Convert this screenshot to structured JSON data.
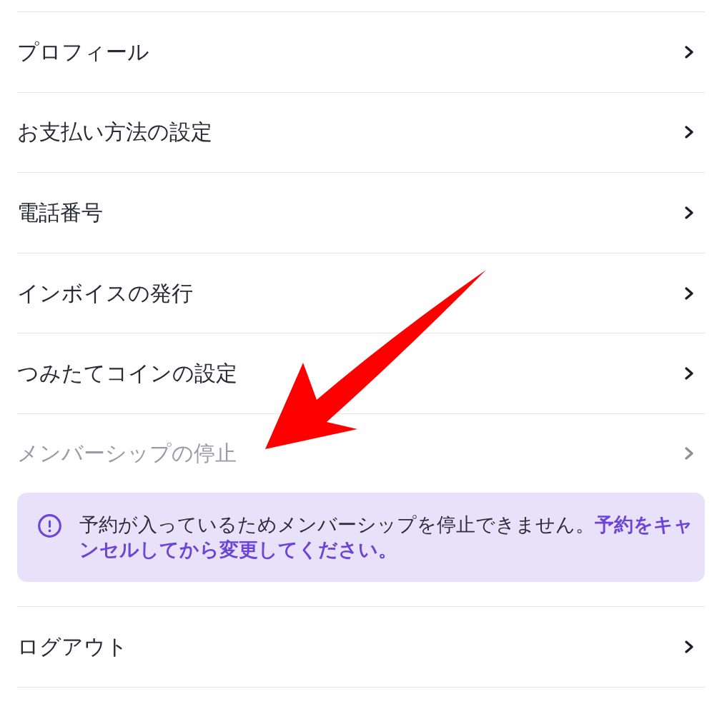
{
  "settings_list": [
    {
      "kind": "link",
      "label": "プロフィール",
      "disabled": false
    },
    {
      "kind": "link",
      "label": "お支払い方法の設定",
      "disabled": false
    },
    {
      "kind": "link",
      "label": "電話番号",
      "disabled": false
    },
    {
      "kind": "link",
      "label": "インボイスの発行",
      "disabled": false
    },
    {
      "kind": "link",
      "label": "つみたてコインの設定",
      "disabled": false
    },
    {
      "kind": "link",
      "label": "メンバーシップの停止",
      "disabled": true
    },
    {
      "kind": "notice",
      "text": "予約が入っているためメンバーシップを停止できません。**予約をキャンセルしてから変更してください。**"
    },
    {
      "kind": "link",
      "label": "ログアウト",
      "disabled": false
    }
  ]
}
